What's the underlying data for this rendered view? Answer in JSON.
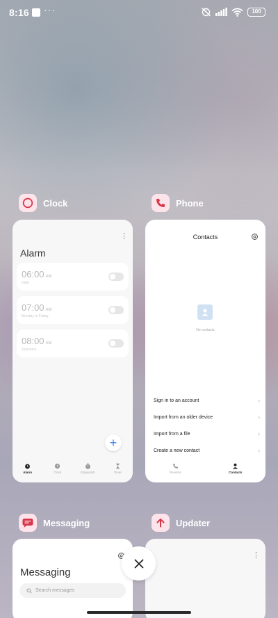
{
  "status_bar": {
    "time": "8:16",
    "more": "···",
    "battery": "100"
  },
  "clock": {
    "app_name": "Clock",
    "icon": "clock-icon",
    "icon_bg": "#fde4ea",
    "title": "Alarm",
    "alarms": [
      {
        "time": "06:00",
        "ampm": "AM",
        "sub": "Daily"
      },
      {
        "time": "07:00",
        "ampm": "AM",
        "sub": "Monday to Friday"
      },
      {
        "time": "08:00",
        "ampm": "AM",
        "sub": "Just once"
      }
    ],
    "fab": "+",
    "tabs": [
      "Alarm",
      "Clock",
      "Stopwatch",
      "Timer"
    ]
  },
  "phone": {
    "app_name": "Phone",
    "icon": "phone-icon",
    "icon_bg": "#fde4ea",
    "title": "Contacts",
    "empty_text": "No contacts",
    "menu": [
      "Sign in to an account",
      "Import from an older device",
      "Import from a file",
      "Create a new contact"
    ],
    "tabs": [
      "Recents",
      "Contacts"
    ]
  },
  "messaging": {
    "app_name": "Messaging",
    "icon": "chat-bubble-icon",
    "icon_bg": "#fde4ea",
    "title": "Messaging",
    "search_placeholder": "Search messages"
  },
  "updater": {
    "app_name": "Updater",
    "icon": "arrow-up-icon",
    "icon_bg": "#fde4ea"
  },
  "colors": {
    "accent": "#3c84e8",
    "icon_red": "#d9354a"
  }
}
